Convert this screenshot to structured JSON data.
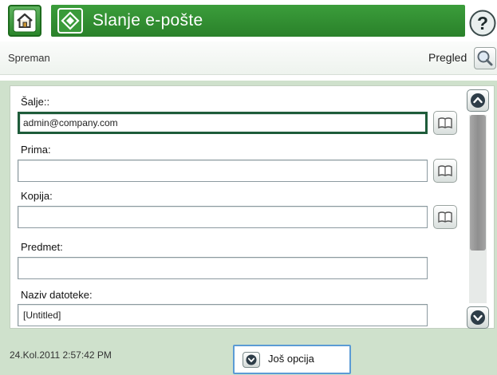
{
  "header": {
    "title": "Slanje e-pošte",
    "home_icon": "home-icon",
    "start_icon": "start-icon",
    "help_icon": "help-icon",
    "colors": {
      "header_green": "#2f8c2f"
    }
  },
  "status": {
    "text": "Spreman",
    "preview_label": "Pregled",
    "preview_icon": "magnifier-icon"
  },
  "form": {
    "from_label": "Šalje::",
    "from_value": "admin@company.com",
    "to_label": "Prima:",
    "to_value": "",
    "cc_label": "Kopija:",
    "cc_value": "",
    "subject_label": "Predmet:",
    "subject_value": "",
    "filename_label": "Naziv datoteke:",
    "filename_value": "[Untitled]",
    "address_book_icon": "address-book-icon"
  },
  "footer": {
    "datetime": "24.Kol.2011 2:57:42 PM",
    "more_options_label": "Još opcija"
  }
}
